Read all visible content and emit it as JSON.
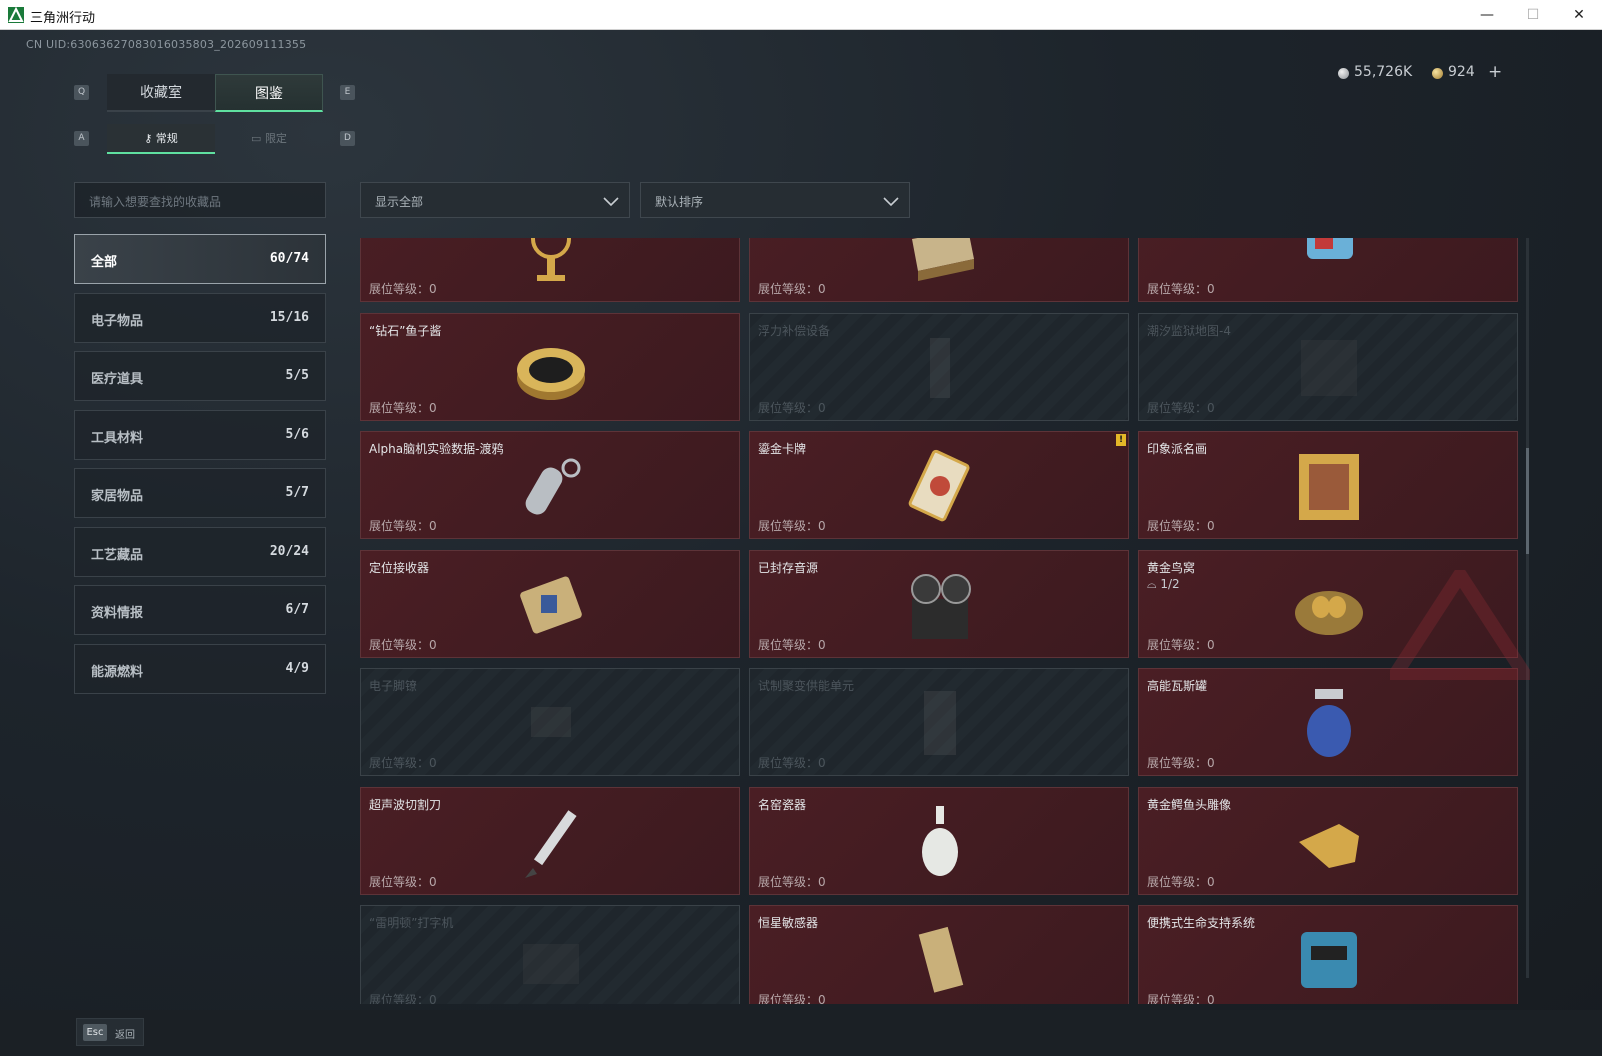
{
  "window": {
    "title": "三角洲行动",
    "minimize": "—",
    "maximize": "☐",
    "close": "✕"
  },
  "uid": "CN UID:63063627083016035803_202609111355",
  "currency": {
    "silver": "55,726K",
    "gold": "924",
    "add": "+"
  },
  "keyhints": {
    "q": "Q",
    "e": "E",
    "a": "A",
    "d": "D"
  },
  "tabs": {
    "main": [
      "收藏室",
      "图鉴"
    ],
    "sub": [
      "常规",
      "限定"
    ]
  },
  "search": {
    "placeholder": "请输入想要查找的收藏品"
  },
  "categories": [
    {
      "label": "全部",
      "count": "60/74"
    },
    {
      "label": "电子物品",
      "count": "15/16"
    },
    {
      "label": "医疗道具",
      "count": "5/5"
    },
    {
      "label": "工具材料",
      "count": "5/6"
    },
    {
      "label": "家居物品",
      "count": "5/7"
    },
    {
      "label": "工艺藏品",
      "count": "20/24"
    },
    {
      "label": "资料情报",
      "count": "6/7"
    },
    {
      "label": "能源燃料",
      "count": "4/9"
    }
  ],
  "filters": {
    "show": "显示全部",
    "sort": "默认排序"
  },
  "level_label": "展位等级：0",
  "items": [
    {
      "name": "",
      "icon": "armillary-icon"
    },
    {
      "name": "",
      "icon": "chess-box-icon"
    },
    {
      "name": "",
      "icon": "machine-icon"
    },
    {
      "name": "“钻石”鱼子酱",
      "icon": "caviar-tin-icon"
    },
    {
      "name": "浮力补偿设备",
      "icon": "buoyancy-device-icon"
    },
    {
      "name": "潮汐监狱地图-4",
      "icon": "map-icon"
    },
    {
      "name": "Alpha脑机实验数据-渡鸦",
      "icon": "data-capsule-icon"
    },
    {
      "name": "鎏金卡牌",
      "icon": "gilded-card-icon",
      "alert": "!"
    },
    {
      "name": "印象派名画",
      "icon": "painting-icon"
    },
    {
      "name": "定位接收器",
      "icon": "receiver-icon"
    },
    {
      "name": "已封存音源",
      "icon": "reel-recorder-icon"
    },
    {
      "name": "黄金鸟窝",
      "icon": "golden-nest-icon",
      "sub": "1/2"
    },
    {
      "name": "电子脚镣",
      "icon": "ankle-monitor-icon"
    },
    {
      "name": "试制聚变供能单元",
      "icon": "fusion-cell-icon"
    },
    {
      "name": "高能瓦斯罐",
      "icon": "gas-canister-icon"
    },
    {
      "name": "超声波切割刀",
      "icon": "ultrasonic-knife-icon"
    },
    {
      "name": "名窑瓷器",
      "icon": "porcelain-vase-icon"
    },
    {
      "name": "黄金鳄鱼头雕像",
      "icon": "crocodile-head-icon"
    },
    {
      "name": "“雷明顿”打字机",
      "icon": "typewriter-icon"
    },
    {
      "name": "恒星敏感器",
      "icon": "star-sensor-icon"
    },
    {
      "name": "便携式生命支持系统",
      "icon": "life-support-icon"
    }
  ],
  "bottom": {
    "esc": "Esc",
    "back": "返回"
  },
  "colors": {
    "accent": "#5fe0a0",
    "owned_card": "#4a1e24",
    "locked_card": "#1f262c",
    "alert": "#e3b728"
  }
}
